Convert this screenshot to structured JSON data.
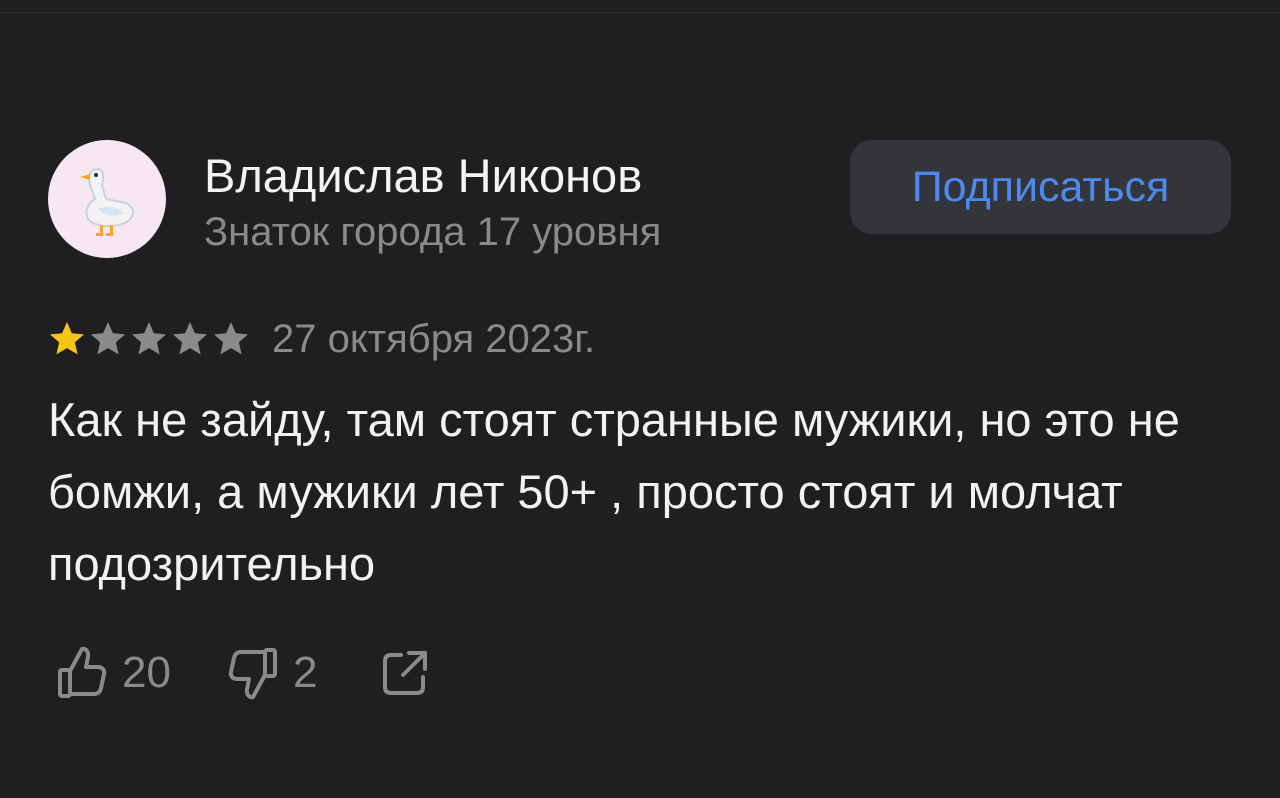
{
  "review": {
    "author": {
      "name": "Владислав Никонов",
      "level": "Знаток города 17 уровня",
      "avatar_icon": "goose-icon",
      "avatar_bg": "#f6e7f0"
    },
    "subscribe_label": "Подписаться",
    "rating": {
      "value": 1,
      "max": 5,
      "filled_color": "#f5c518",
      "empty_color": "#8a8a8d"
    },
    "date": "27 октября 2023г.",
    "text": "Как не зайду, там стоят странные мужики, но это не бомжи, а мужики лет 50+ , просто стоят и молчат подозрительно",
    "likes": "20",
    "dislikes": "2",
    "icons": {
      "like": "thumbs-up-icon",
      "dislike": "thumbs-down-icon",
      "share": "share-icon"
    }
  },
  "colors": {
    "background": "#1f1f21",
    "accent": "#4d8af0",
    "button_bg": "#34353b",
    "muted_text": "#8a8a8d"
  }
}
